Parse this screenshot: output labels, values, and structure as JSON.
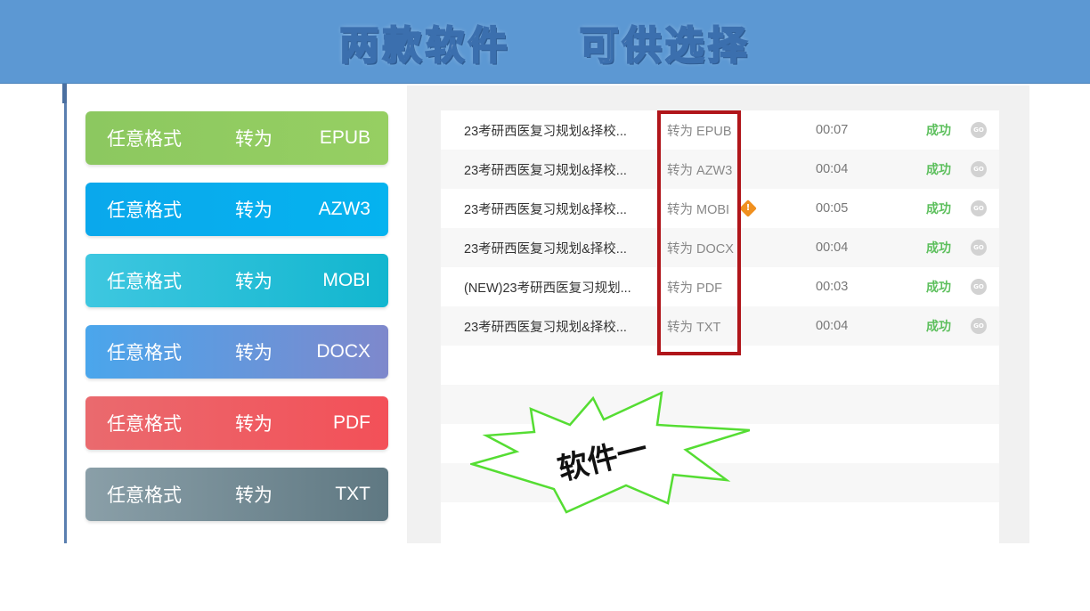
{
  "banner": {
    "title": "两款软件    可供选择"
  },
  "converters": [
    {
      "left": "任意格式",
      "mid": "转为",
      "right": "EPUB",
      "gradient": [
        "#8cc860",
        "#96cf62"
      ]
    },
    {
      "left": "任意格式",
      "mid": "转为",
      "right": "AZW3",
      "gradient": [
        "#0aa8ec",
        "#05b3ef"
      ]
    },
    {
      "left": "任意格式",
      "mid": "转为",
      "right": "MOBI",
      "gradient": [
        "#3ec7e0",
        "#12b6cf"
      ]
    },
    {
      "left": "任意格式",
      "mid": "转为",
      "right": "DOCX",
      "gradient": [
        "#4aa6ec",
        "#7e88cc"
      ]
    },
    {
      "left": "任意格式",
      "mid": "转为",
      "right": "PDF",
      "gradient": [
        "#ea6a6e",
        "#f35058"
      ]
    },
    {
      "left": "任意格式",
      "mid": "转为",
      "right": "TXT",
      "gradient": [
        "#8a9fa8",
        "#5f7882"
      ]
    }
  ],
  "tasks": [
    {
      "name": "23考研西医复习规划&择校...",
      "format": "转为 EPUB",
      "time": "00:07",
      "status": "成功",
      "go": "GO",
      "warning": false
    },
    {
      "name": "23考研西医复习规划&择校...",
      "format": "转为 AZW3",
      "time": "00:04",
      "status": "成功",
      "go": "GO",
      "warning": false
    },
    {
      "name": "23考研西医复习规划&择校...",
      "format": "转为 MOBI",
      "time": "00:05",
      "status": "成功",
      "go": "GO",
      "warning": true
    },
    {
      "name": "23考研西医复习规划&择校...",
      "format": "转为 DOCX",
      "time": "00:04",
      "status": "成功",
      "go": "GO",
      "warning": false
    },
    {
      "name": "(NEW)23考研西医复习规划...",
      "format": "转为 PDF",
      "time": "00:03",
      "status": "成功",
      "go": "GO",
      "warning": false
    },
    {
      "name": "23考研西医复习规划&择校...",
      "format": "转为 TXT",
      "time": "00:04",
      "status": "成功",
      "go": "GO",
      "warning": false
    }
  ],
  "callout": {
    "text": "软件一"
  },
  "colors": {
    "highlight": "#b0151a",
    "success": "#5cbf5c",
    "burst_stroke": "#55dd33"
  }
}
